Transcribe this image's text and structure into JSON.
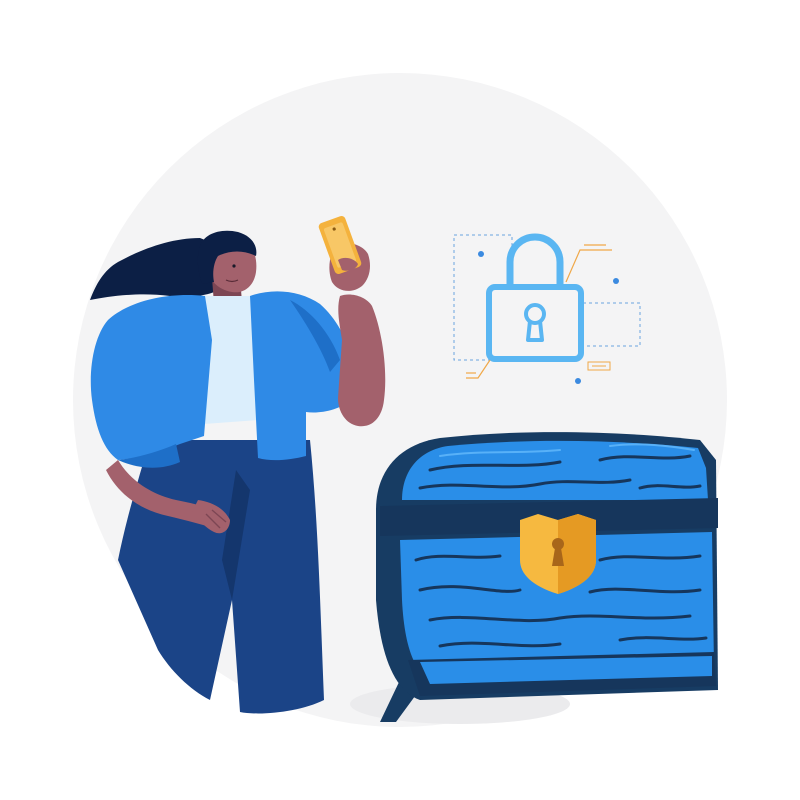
{
  "illustration": {
    "subject": "woman-with-phone-and-treasure-chest",
    "elements": [
      "woman",
      "phone",
      "padlock",
      "treasure-chest",
      "keyhole-shield"
    ]
  },
  "colors": {
    "background_circle": "#f4f4f5",
    "hair": "#0c1f45",
    "skin": "#a3616c",
    "skin_dark": "#7d4654",
    "jacket": "#2f8ae6",
    "jacket_shade": "#1e6fc8",
    "shirt": "#dbeefc",
    "pants": "#1b4487",
    "pants_dark": "#14366d",
    "phone": "#f4b23d",
    "padlock": "#5ab6f2",
    "accent_dots": "#3b8ae0",
    "accent_lines": "#f0a848",
    "chest_frame": "#173c63",
    "chest_wood": "#2a8ee8",
    "chest_swirl": "#16365c",
    "lock_plate": "#f6b940",
    "lock_plate_dark": "#e59a23"
  },
  "icons": {
    "padlock": "padlock-icon",
    "keyhole": "keyhole-icon"
  }
}
